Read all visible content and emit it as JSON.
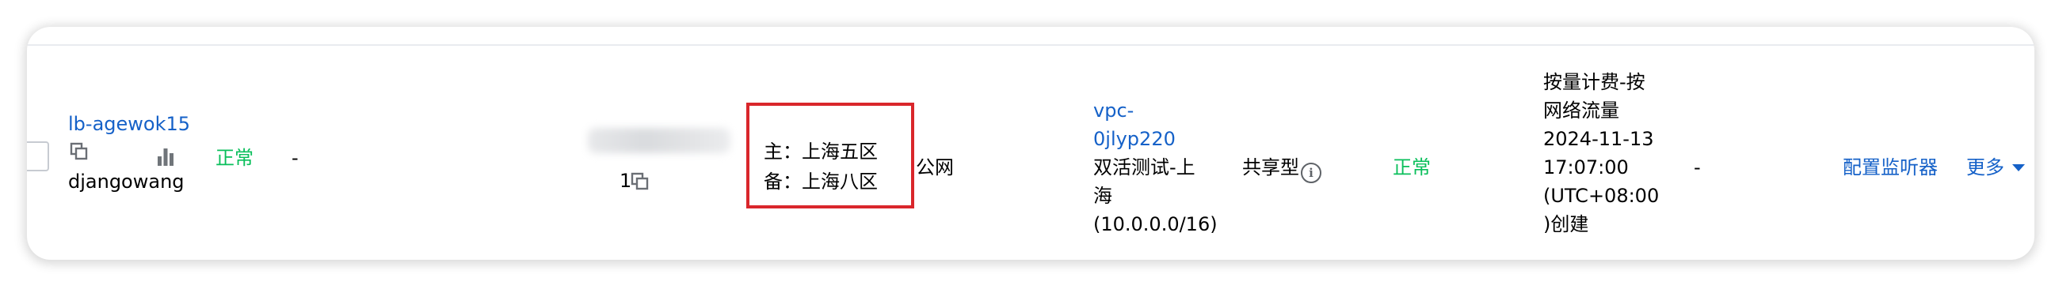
{
  "row": {
    "instance": {
      "id": "lb-agewok15",
      "name": "djangowang"
    },
    "status": "正常",
    "tag": "-",
    "vip_count": "1",
    "zones": {
      "master": "主：上海五区",
      "backup": "备：上海八区"
    },
    "network_type": "公网",
    "vpc": {
      "id_line1": "vpc-",
      "id_line2": "0jlyp220",
      "name_line1": "双活测试-上",
      "name_line2": "海",
      "cidr": "(10.0.0.0/16)"
    },
    "instance_type": "共享型",
    "health_status": "正常",
    "billing": {
      "line1": "按量计费-按",
      "line2": "网络流量",
      "date": "2024-11-13",
      "time": "17:07:00",
      "tz": "(UTC+08:00",
      "created": ")创建"
    },
    "expire": "-",
    "actions": {
      "configure": "配置监听器",
      "more": "更多"
    }
  },
  "colors": {
    "link": "#1561c8",
    "success": "#0abf5b",
    "highlight_box": "#d9262b"
  },
  "icons": [
    "copy-icon",
    "bar-chart-icon",
    "info-icon",
    "caret-down-icon"
  ]
}
